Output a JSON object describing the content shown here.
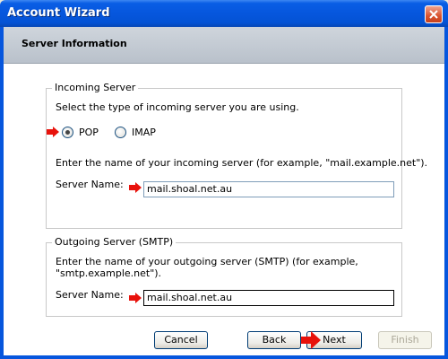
{
  "window": {
    "title": "Account Wizard",
    "close_icon": "close-icon"
  },
  "header": {
    "title": "Server Information"
  },
  "incoming": {
    "legend": "Incoming Server",
    "prompt": "Select the type of incoming server you are using.",
    "options": [
      {
        "label": "POP",
        "selected": true
      },
      {
        "label": "IMAP",
        "selected": false
      }
    ],
    "instruction": "Enter the name of your incoming server (for example, \"mail.example.net\").",
    "server_label": "Server Name:",
    "server_value": "mail.shoal.net.au"
  },
  "outgoing": {
    "legend": "Outgoing Server (SMTP)",
    "instruction_line1": "Enter the name of your outgoing server (SMTP) (for example,",
    "instruction_line2": "\"smtp.example.net\").",
    "server_label": "Server Name:",
    "server_value": "mail.shoal.net.au"
  },
  "buttons": {
    "cancel": "Cancel",
    "back": "Back",
    "next": "Next",
    "finish": "Finish"
  },
  "colors": {
    "titlebar": "#0656dd",
    "arrow": "#e8120c",
    "header_band": "#c4cbd3"
  }
}
